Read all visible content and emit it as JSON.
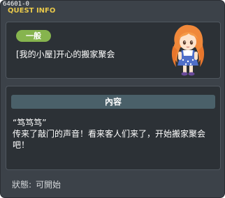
{
  "window": {
    "id": "64601-0",
    "title": "QUEST INFO"
  },
  "quest": {
    "category": "一般",
    "name": "[我的小屋]开心的搬家聚会"
  },
  "content": {
    "header": "內容",
    "lines": [
      "“笃笃笃”",
      "传来了敲门的声音！看来客人们来了，开始搬家聚会吧！"
    ]
  },
  "status": {
    "label": "狀態:",
    "value": "可開始"
  },
  "colors": {
    "background": "#3c4249",
    "panel": "#2c3136",
    "title": "#e8c84a",
    "badge": "#86b44e",
    "header": "#4a6069"
  },
  "icons": {
    "avatar": "character-avatar-orange-hair"
  }
}
